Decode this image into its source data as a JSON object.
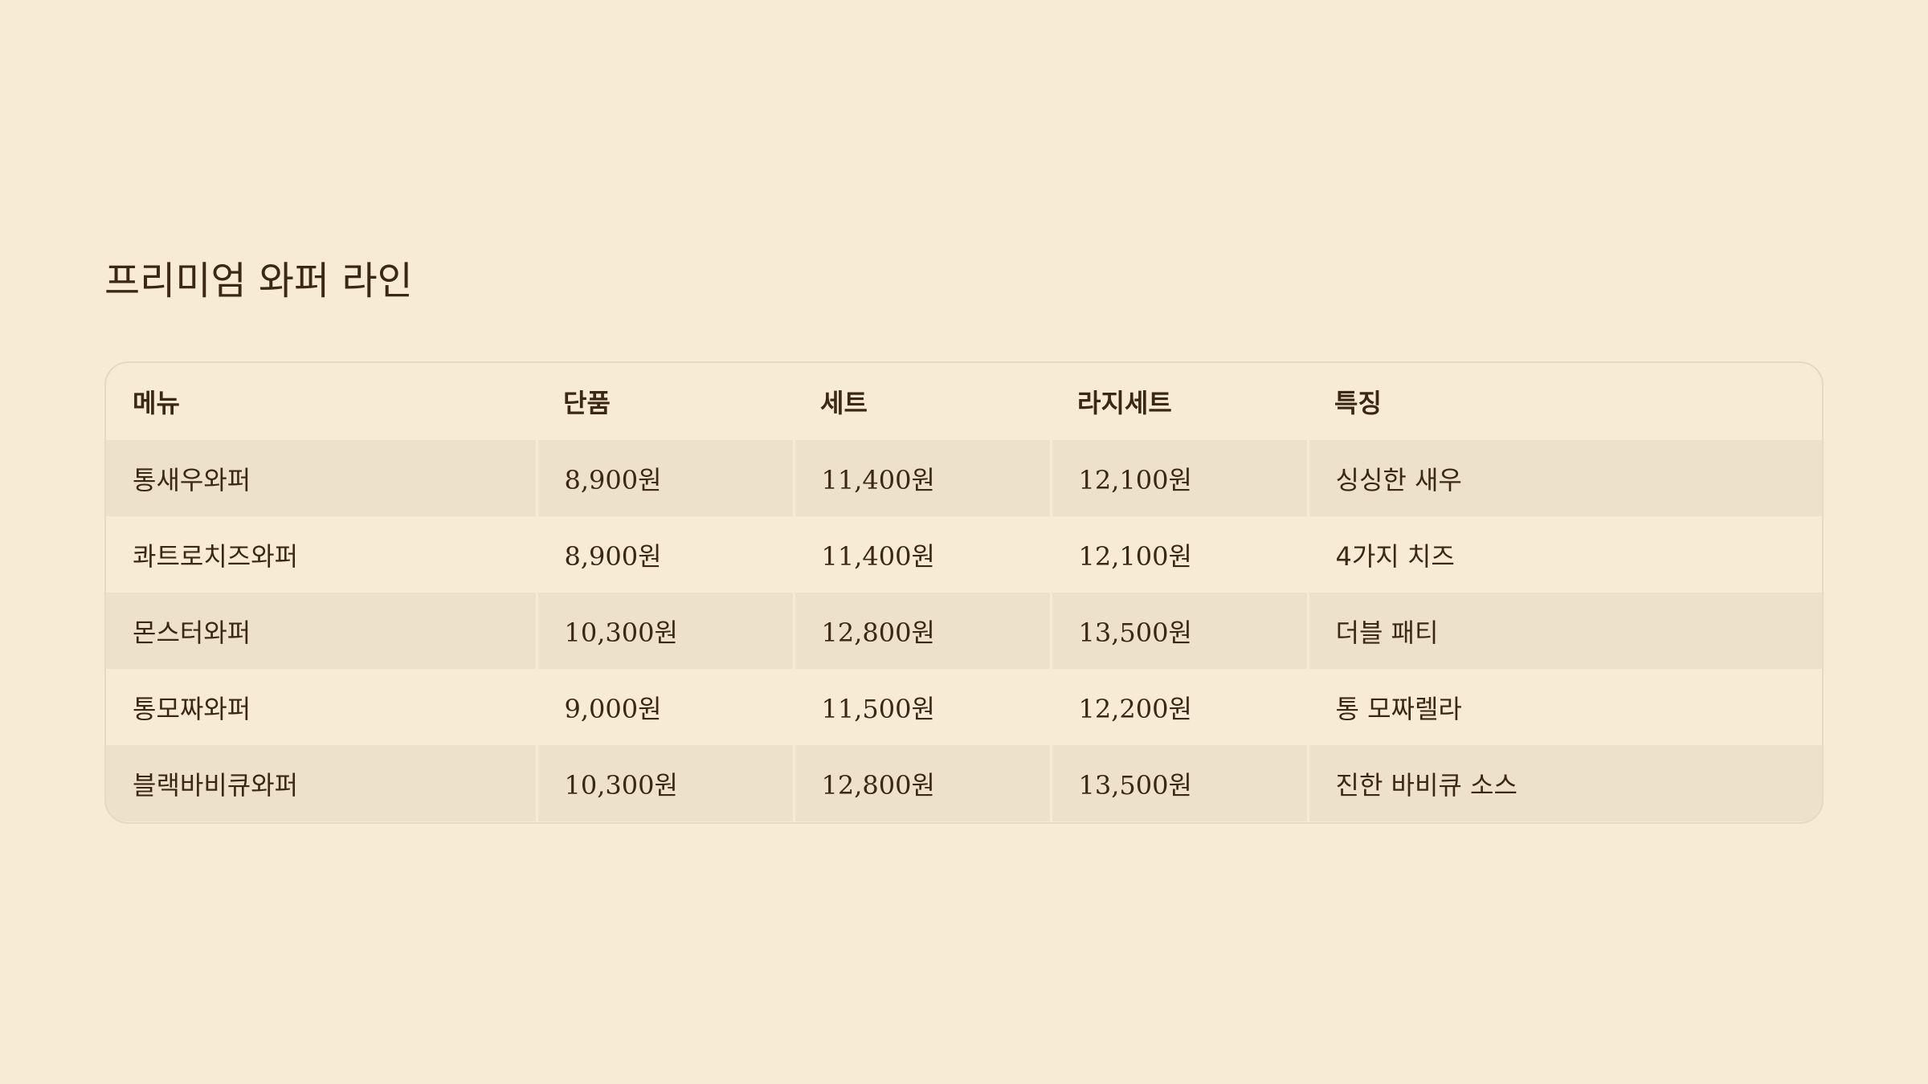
{
  "title": "프리미엄 와퍼 라인",
  "table": {
    "headers": [
      "메뉴",
      "단품",
      "세트",
      "라지세트",
      "특징"
    ],
    "rows": [
      {
        "menu": "통새우와퍼",
        "single": "8,900원",
        "set": "11,400원",
        "large_set": "12,100원",
        "feature": "싱싱한 새우"
      },
      {
        "menu": "콰트로치즈와퍼",
        "single": "8,900원",
        "set": "11,400원",
        "large_set": "12,100원",
        "feature": "4가지 치즈"
      },
      {
        "menu": "몬스터와퍼",
        "single": "10,300원",
        "set": "12,800원",
        "large_set": "13,500원",
        "feature": "더블 패티"
      },
      {
        "menu": "통모짜와퍼",
        "single": "9,000원",
        "set": "11,500원",
        "large_set": "12,200원",
        "feature": "통 모짜렐라"
      },
      {
        "menu": "블랙바비큐와퍼",
        "single": "10,300원",
        "set": "12,800원",
        "large_set": "13,500원",
        "feature": "진한 바비큐 소스"
      }
    ]
  },
  "colors": {
    "background": "#f7ebd6",
    "row_alt": "#ede1ca",
    "text": "#3a2814",
    "border": "#e6d9c2"
  }
}
